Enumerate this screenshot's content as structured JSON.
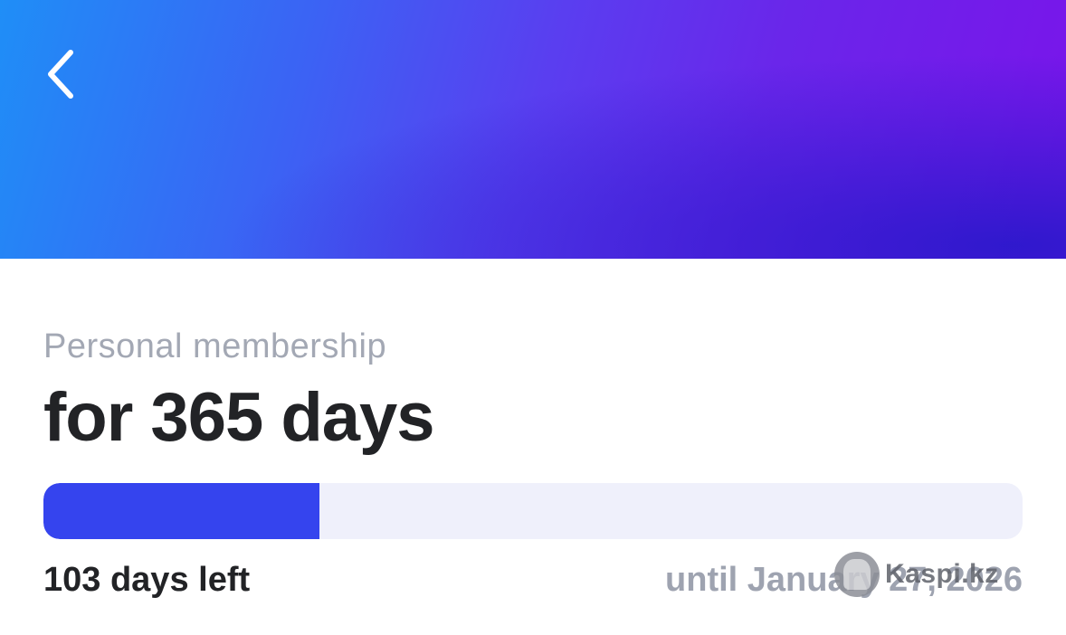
{
  "header": {
    "back_icon": "chevron-left-icon",
    "gradient_colors": [
      "#1f8ef7",
      "#5a3ef0",
      "#7a14ea",
      "#2319c8"
    ]
  },
  "membership": {
    "type_label": "Personal membership",
    "duration_title": "for 365 days",
    "progress": {
      "elapsed_fraction": 0.282,
      "fill_color": "#3544ee",
      "track_color": "#eff0fb"
    },
    "days_left_text": "103 days left",
    "expiry_text": "until January 27, 2026"
  },
  "watermark": {
    "text": "Kaspi.kz"
  }
}
